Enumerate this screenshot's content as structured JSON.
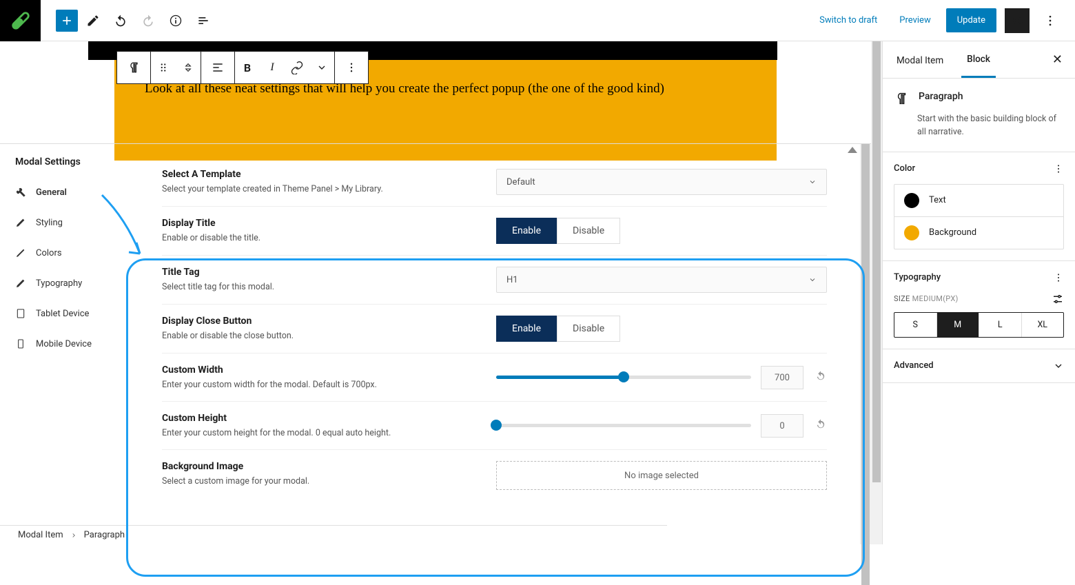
{
  "topbar": {
    "switch_to_draft": "Switch to draft",
    "preview": "Preview",
    "update": "Update"
  },
  "popup": {
    "text": "Look at all these neat settings that will help you create the perfect popup (the one of the good kind)"
  },
  "crumbs": {
    "a": "Modal Item",
    "b": "Paragraph"
  },
  "settings": {
    "title": "Modal Settings",
    "nav": {
      "general": "General",
      "styling": "Styling",
      "colors": "Colors",
      "typography": "Typography",
      "tablet": "Tablet Device",
      "mobile": "Mobile Device"
    },
    "template": {
      "title": "Select A Template",
      "desc": "Select your template created in Theme Panel > My Library.",
      "value": "Default"
    },
    "display_title": {
      "title": "Display Title",
      "desc": "Enable or disable the title.",
      "enable": "Enable",
      "disable": "Disable"
    },
    "title_tag": {
      "title": "Title Tag",
      "desc": "Select title tag for this modal.",
      "value": "H1"
    },
    "close_btn": {
      "title": "Display Close Button",
      "desc": "Enable or disable the close button.",
      "enable": "Enable",
      "disable": "Disable"
    },
    "width": {
      "title": "Custom Width",
      "desc": "Enter your custom width for the modal. Default is 700px.",
      "value": "700"
    },
    "height": {
      "title": "Custom Height",
      "desc": "Enter your custom height for the modal. 0 equal auto height.",
      "value": "0"
    },
    "bg": {
      "title": "Background Image",
      "desc": "Select a custom image for your modal.",
      "value": "No image selected"
    }
  },
  "sidebar": {
    "tab_item": "Modal Item",
    "tab_block": "Block",
    "block": {
      "name": "Paragraph",
      "desc": "Start with the basic building block of all narrative."
    },
    "color_h": "Color",
    "color_text": "Text",
    "color_bg": "Background",
    "typo_h": "Typography",
    "size_label": "SIZE",
    "size_val": "MEDIUM(PX)",
    "sizes": {
      "s": "S",
      "m": "M",
      "l": "L",
      "xl": "XL"
    },
    "advanced": "Advanced"
  },
  "colors": {
    "accent": "#007cba",
    "popup_bg": "#F2A900",
    "swatch_text": "#000000",
    "swatch_bg": "#F2A900"
  }
}
